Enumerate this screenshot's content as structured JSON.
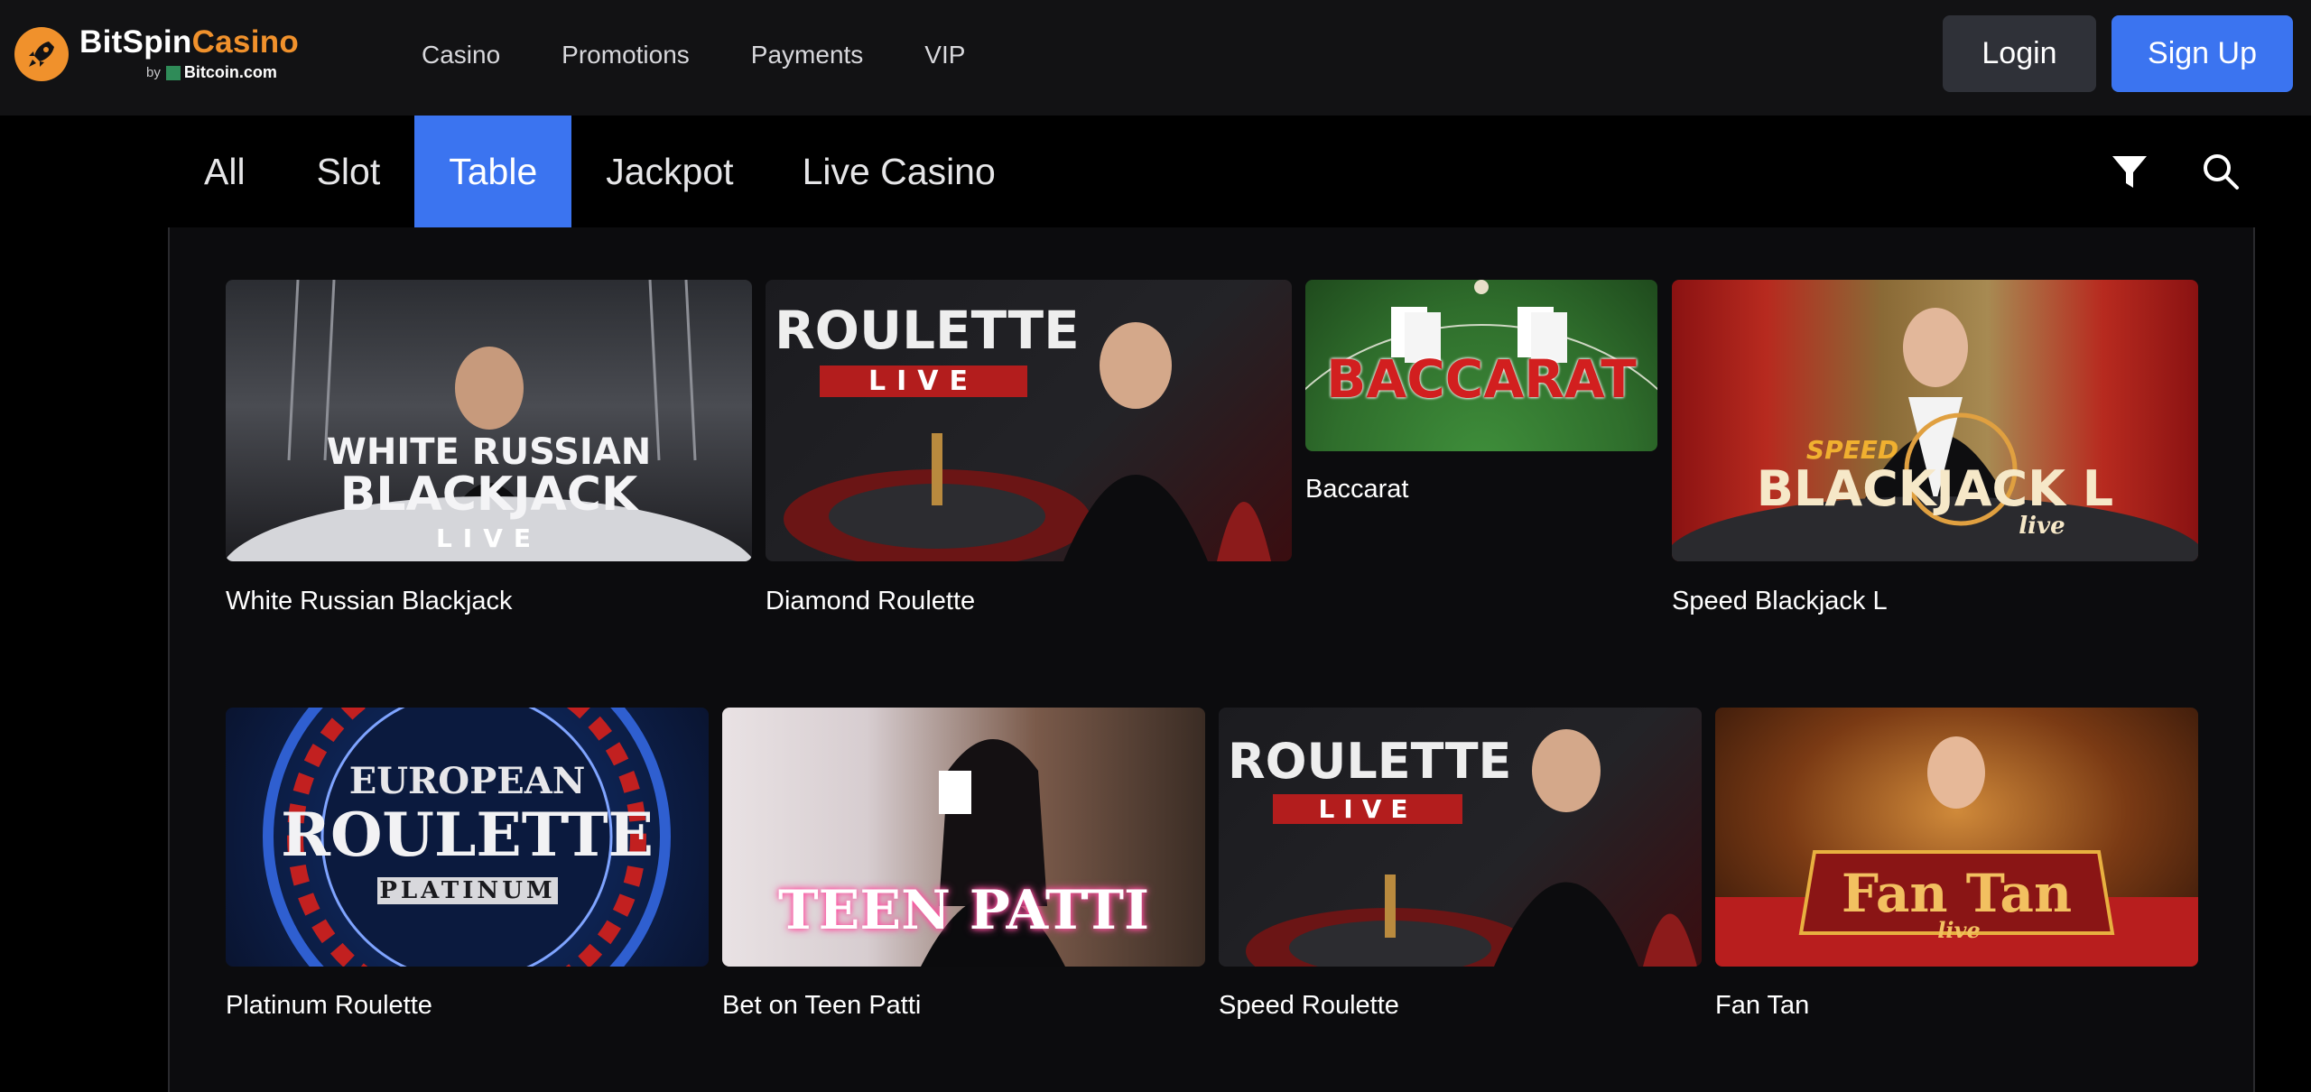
{
  "brand": {
    "name_part1": "BitSpin",
    "name_part2": "Casino",
    "by": "by",
    "partner": "Bitcoin.com"
  },
  "nav": {
    "items": [
      "Casino",
      "Promotions",
      "Payments",
      "VIP"
    ]
  },
  "auth": {
    "login_label": "Login",
    "signup_label": "Sign Up"
  },
  "tabs": {
    "items": [
      "All",
      "Slot",
      "Table",
      "Jackpot",
      "Live Casino"
    ],
    "active": "Table"
  },
  "games": {
    "row1": [
      {
        "title": "White Russian Blackjack",
        "art_line1": "WHITE RUSSIAN",
        "art_line2": "BLACKJACK",
        "art_line3": "LIVE"
      },
      {
        "title": "Diamond Roulette",
        "art_line1": "ROULETTE",
        "art_line2": "LIVE"
      },
      {
        "title": "Baccarat",
        "art_line1": "BACCARAT"
      },
      {
        "title": "Speed Blackjack L",
        "art_line1": "SPEED",
        "art_line2": "BLACKJACK L",
        "art_line3": "live"
      }
    ],
    "row2": [
      {
        "title": "Platinum Roulette",
        "art_line1": "EUROPEAN",
        "art_line2": "ROULETTE",
        "art_line3": "PLATINUM"
      },
      {
        "title": "Bet on Teen Patti",
        "art_line1": "TEEN PATTI"
      },
      {
        "title": "Speed Roulette",
        "art_line1": "ROULETTE",
        "art_line2": "LIVE"
      },
      {
        "title": "Fan Tan",
        "art_line1": "Fan Tan",
        "art_line2": "live"
      }
    ]
  },
  "colors": {
    "accent": "#3b74f0",
    "brand_orange": "#f0912c",
    "header_bg": "#121214",
    "panel_bg": "#0c0c0e"
  },
  "icons": [
    "rocket-logo-icon",
    "filter-icon",
    "search-icon"
  ]
}
